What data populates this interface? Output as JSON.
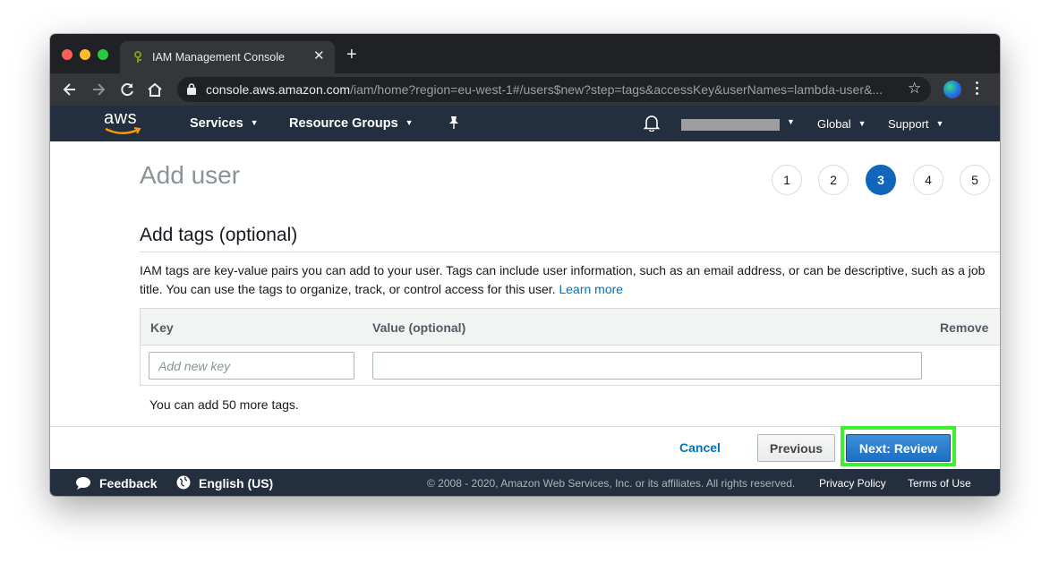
{
  "browser": {
    "tab_title": "IAM Management Console",
    "url_host": "console.aws.amazon.com",
    "url_rest": "/iam/home?region=eu-west-1#/users$new?step=tags&accessKey&userNames=lambda-user&..."
  },
  "awsnav": {
    "logo_text": "aws",
    "services": "Services",
    "resource_groups": "Resource Groups",
    "region": "Global",
    "support": "Support"
  },
  "page": {
    "title": "Add user",
    "steps": [
      "1",
      "2",
      "3",
      "4",
      "5"
    ],
    "active_step": "3",
    "section_title": "Add tags (optional)",
    "description": "IAM tags are key-value pairs you can add to your user. Tags can include user information, such as an email address, or can be descriptive, such as a job title. You can use the tags to organize, track, or control access for this user.",
    "learn_more": "Learn more"
  },
  "table": {
    "col_key": "Key",
    "col_value": "Value (optional)",
    "col_remove": "Remove",
    "key_placeholder": "Add new key",
    "key_value": "",
    "value_value": ""
  },
  "more_tags": "You can add 50 more tags.",
  "actions": {
    "cancel": "Cancel",
    "previous": "Previous",
    "next": "Next: Review"
  },
  "footer": {
    "feedback": "Feedback",
    "language": "English (US)",
    "copyright": "© 2008 - 2020, Amazon Web Services, Inc. or its affiliates. All rights reserved.",
    "privacy": "Privacy Policy",
    "terms": "Terms of Use"
  },
  "colors": {
    "aws_nav": "#232f3e",
    "active_step": "#1166bb",
    "primary_button": "#1b6ec2",
    "highlight": "#3cf030",
    "link": "#0073bb"
  }
}
